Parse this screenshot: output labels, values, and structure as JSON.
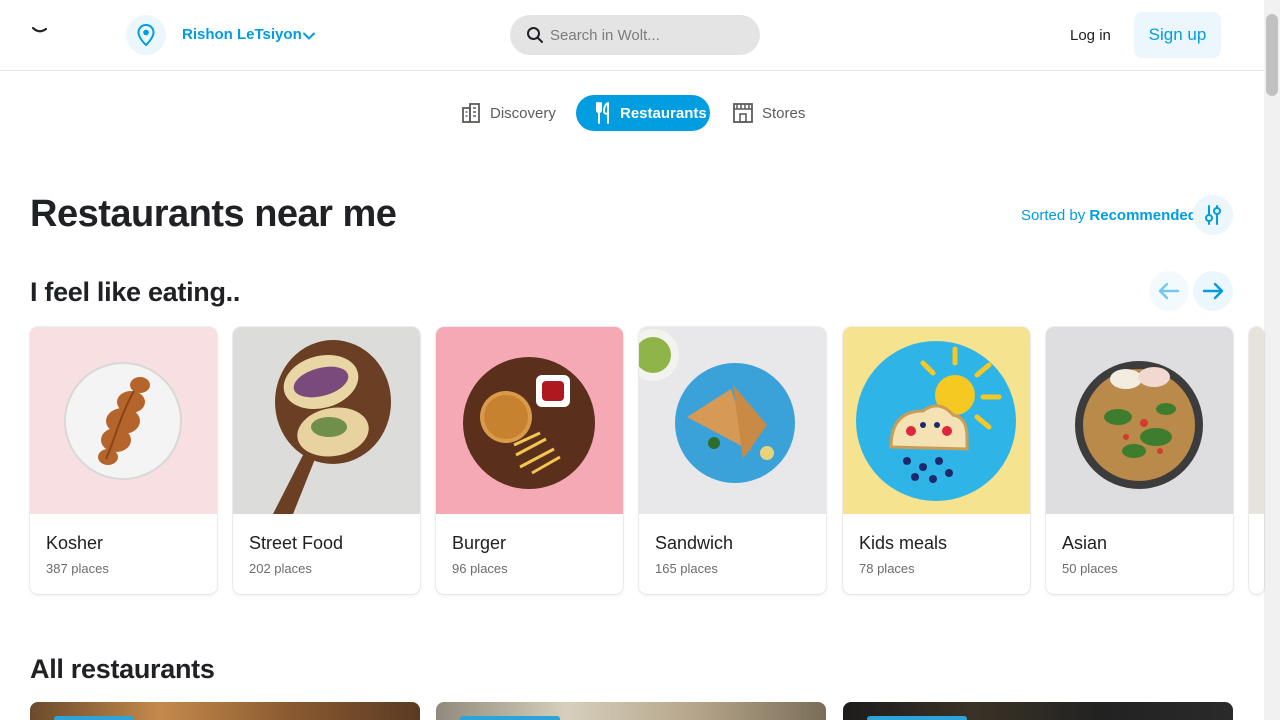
{
  "header": {
    "location": "Rishon LeTsiyon",
    "search_placeholder": "Search in Wolt...",
    "login": "Log in",
    "signup": "Sign up"
  },
  "tabs": [
    {
      "label": "Discovery",
      "icon": "buildings-icon",
      "active": false
    },
    {
      "label": "Restaurants",
      "icon": "fork-knife-icon",
      "active": true
    },
    {
      "label": "Stores",
      "icon": "store-icon",
      "active": false
    }
  ],
  "main": {
    "title": "Restaurants near me",
    "sorted_prefix": "Sorted by",
    "sorted_value": "Recommended",
    "eating_title": "I feel like eating..",
    "all_title": "All restaurants"
  },
  "categories": [
    {
      "name": "Kosher",
      "count": "387 places"
    },
    {
      "name": "Street Food",
      "count": "202 places"
    },
    {
      "name": "Burger",
      "count": "96 places"
    },
    {
      "name": "Sandwich",
      "count": "165 places"
    },
    {
      "name": "Kids meals",
      "count": "78 places"
    },
    {
      "name": "Asian",
      "count": "50 places"
    }
  ],
  "colors": {
    "accent": "#009de0",
    "accent_light": "#ebf7fd"
  }
}
